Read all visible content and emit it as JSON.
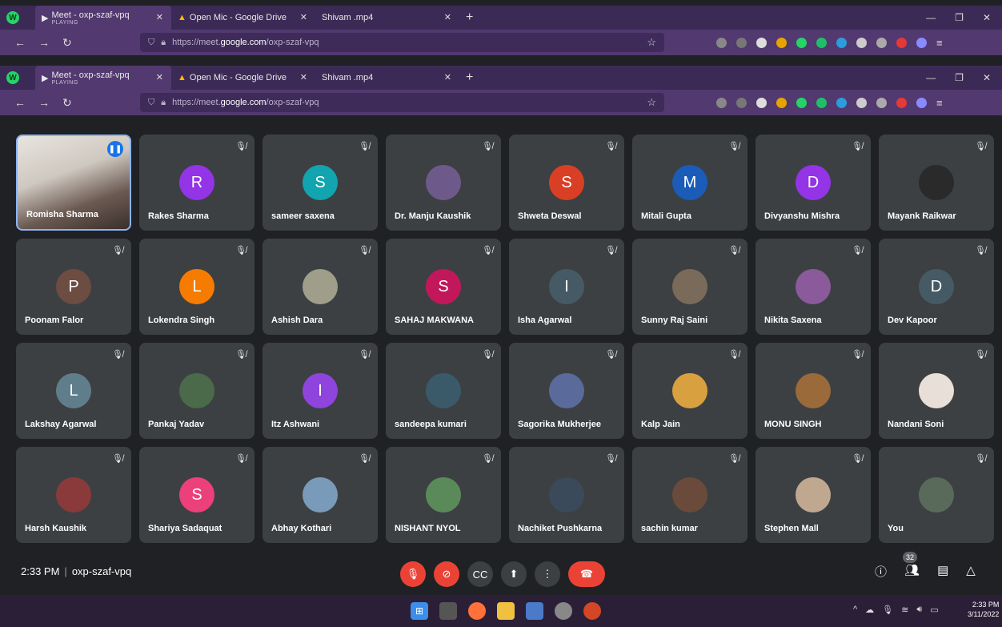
{
  "browser": {
    "tabs": [
      {
        "title": "Meet - oxp-szaf-vpq",
        "sub": "PLAYING"
      },
      {
        "title": "Open Mic - Google Drive"
      },
      {
        "title": "Shivam .mp4"
      }
    ],
    "url_prefix": "https://meet.",
    "url_domain": "google.com",
    "url_path": "/oxp-szaf-vpq"
  },
  "participants": [
    {
      "name": "Romisha Sharma",
      "initial": "",
      "color": "#8d6e63",
      "photo": true,
      "active": true
    },
    {
      "name": "Rakes Sharma",
      "initial": "R",
      "color": "#9334e6"
    },
    {
      "name": "sameer saxena",
      "initial": "S",
      "color": "#12a4af"
    },
    {
      "name": "Dr. Manju Kaushik",
      "initial": "",
      "color": "#6d5a8a",
      "photo": true
    },
    {
      "name": "Shweta Deswal",
      "initial": "S",
      "color": "#d93f25"
    },
    {
      "name": "Mitali Gupta",
      "initial": "M",
      "color": "#1a5cb8"
    },
    {
      "name": "Divyanshu Mishra",
      "initial": "D",
      "color": "#9334e6"
    },
    {
      "name": "Mayank Raikwar",
      "initial": "",
      "color": "#2a2a2a",
      "photo": true
    },
    {
      "name": "Poonam Falor",
      "initial": "P",
      "color": "#6d4c41"
    },
    {
      "name": "Lokendra Singh",
      "initial": "L",
      "color": "#f57c00"
    },
    {
      "name": "Ashish Dara",
      "initial": "",
      "color": "#9e9e8a",
      "photo": true
    },
    {
      "name": "SAHAJ MAKWANA",
      "initial": "S",
      "color": "#c2185b"
    },
    {
      "name": "Isha Agarwal",
      "initial": "I",
      "color": "#455a64"
    },
    {
      "name": "Sunny Raj Saini",
      "initial": "",
      "color": "#7a6a5a",
      "photo": true
    },
    {
      "name": "Nikita Saxena",
      "initial": "",
      "color": "#8a5a9a",
      "photo": true
    },
    {
      "name": "Dev Kapoor",
      "initial": "D",
      "color": "#455a64"
    },
    {
      "name": "Lakshay Agarwal",
      "initial": "L",
      "color": "#607d8b"
    },
    {
      "name": "Pankaj Yadav",
      "initial": "",
      "color": "#4a6a4a",
      "photo": true
    },
    {
      "name": "Itz Ashwani",
      "initial": "I",
      "color": "#8e44dd"
    },
    {
      "name": "sandeepa kumari",
      "initial": "",
      "color": "#3a5a6a",
      "photo": true
    },
    {
      "name": "Sagorika Mukherjee",
      "initial": "",
      "color": "#5a6a9a",
      "photo": true
    },
    {
      "name": "Kalp Jain",
      "initial": "",
      "color": "#d9a040",
      "photo": true
    },
    {
      "name": "MONU SINGH",
      "initial": "",
      "color": "#9a6a3a",
      "photo": true
    },
    {
      "name": "Nandani Soni",
      "initial": "",
      "color": "#e8e0d8",
      "photo": true
    },
    {
      "name": "Harsh Kaushik",
      "initial": "",
      "color": "#8a3a3a",
      "photo": true
    },
    {
      "name": "Shariya Sadaquat",
      "initial": "S",
      "color": "#ec407a"
    },
    {
      "name": "Abhay Kothari",
      "initial": "",
      "color": "#7a9aba",
      "photo": true
    },
    {
      "name": "NISHANT NYOL",
      "initial": "",
      "color": "#5a8a5a",
      "photo": true
    },
    {
      "name": "Nachiket Pushkarna",
      "initial": "",
      "color": "#3a4a5a",
      "photo": true
    },
    {
      "name": "sachin kumar",
      "initial": "",
      "color": "#6a4a3a",
      "photo": true
    },
    {
      "name": "Stephen Mall",
      "initial": "",
      "color": "#c0a890",
      "photo": true
    },
    {
      "name": "You",
      "initial": "",
      "color": "#5a6a5a",
      "photo": true
    }
  ],
  "meeting": {
    "time": "2:33 PM",
    "code": "oxp-szaf-vpq",
    "participant_count": "32"
  },
  "taskbar": {
    "time": "2:33 PM",
    "date": "3/11/2022"
  }
}
